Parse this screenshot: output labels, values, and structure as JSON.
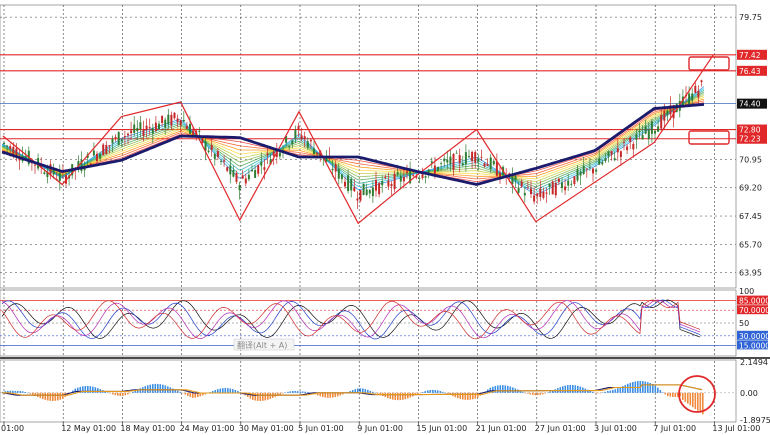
{
  "colors": {
    "background": "#ffffff",
    "grid": "#3a3a3a",
    "ma_thick": "#1b1b6e",
    "zigzag": "#e0282a",
    "level_line": "#e0282a",
    "price_line": "#3b6fb6",
    "tag_red": "#e0282a",
    "tag_navy": "#1b1b6e",
    "tag_blue": "#2f63d6",
    "histogram_pos": "#3d8fe6",
    "histogram_neg": "#f08a3c",
    "signal_line": "#1b1b6e",
    "signal_line2": "#e39a1a",
    "circle": "#e0282a"
  },
  "price_axis": {
    "labels": [
      "79.75",
      "77.42",
      "76.43",
      "74.40",
      "72.80",
      "72.23",
      "70.95",
      "69.20",
      "67.45",
      "65.70",
      "63.95"
    ],
    "current_price": "74.40",
    "level_tags": [
      "77.42",
      "76.43",
      "72.80",
      "72.23"
    ]
  },
  "oscillator_axis": {
    "labels": [
      "100",
      "85.0000",
      "70.0000",
      "50",
      "30.0000",
      "15.0000"
    ],
    "levels": {
      "upper": 85,
      "upper2": 70,
      "mid": 50,
      "lower2": 30,
      "lower": 15
    }
  },
  "macd_axis": {
    "labels": [
      "2.1494",
      "0.00",
      "-1.8975"
    ]
  },
  "time_axis": {
    "labels": [
      "01:00",
      "12 May 01:00",
      "18 May 01:00",
      "24 May 01:00",
      "30 May 01:00",
      "5 Jun 01:00",
      "9 Jun 01:00",
      "15 Jun 01:00",
      "21 Jun 01:00",
      "27 Jun 01:00",
      "3 Jul 01:00",
      "7 Jul 01:00",
      "13 Jul 01:00"
    ]
  },
  "tooltip": {
    "label": "翻译(Alt + A)"
  },
  "chart_data": {
    "type": "line",
    "title": "",
    "x": [
      "01:00",
      "12 May 01:00",
      "18 May 01:00",
      "24 May 01:00",
      "30 May 01:00",
      "5 Jun 01:00",
      "9 Jun 01:00",
      "15 Jun 01:00",
      "21 Jun 01:00",
      "27 Jun 01:00",
      "3 Jul 01:00",
      "7 Jul 01:00",
      "13 Jul 01:00"
    ],
    "ylim": [
      63.0,
      80.5
    ],
    "series": [
      {
        "values": [
          71.4,
          70.2,
          70.9,
          72.4,
          72.3,
          71.1,
          71.1,
          70.2,
          69.4,
          70.4,
          71.5,
          74.1,
          74.4
        ]
      }
    ],
    "zigzag": [
      {
        "x": "01:00",
        "y": 72.4
      },
      {
        "x": "12 May 01:00",
        "y": 69.4
      },
      {
        "x": "18 May 01:00",
        "y": 73.6
      },
      {
        "x": "24 May 01:00",
        "y": 74.5
      },
      {
        "x": "30 May 01:00",
        "y": 67.2
      },
      {
        "x": "5 Jun 01:00",
        "y": 73.9
      },
      {
        "x": "9 Jun 01:00",
        "y": 67.0
      },
      {
        "x": "15 Jun 01:00",
        "y": 70.0
      },
      {
        "x": "21 Jun 01:00",
        "y": 72.8
      },
      {
        "x": "27 Jun 01:00",
        "y": 67.1
      },
      {
        "x": "7 Jul 01:00",
        "y": 72.0
      },
      {
        "x": "13 Jul 01:00",
        "y": 77.42
      }
    ],
    "horizontal_levels": [
      77.42,
      76.43,
      74.4,
      72.8,
      72.23
    ],
    "grid": true
  }
}
